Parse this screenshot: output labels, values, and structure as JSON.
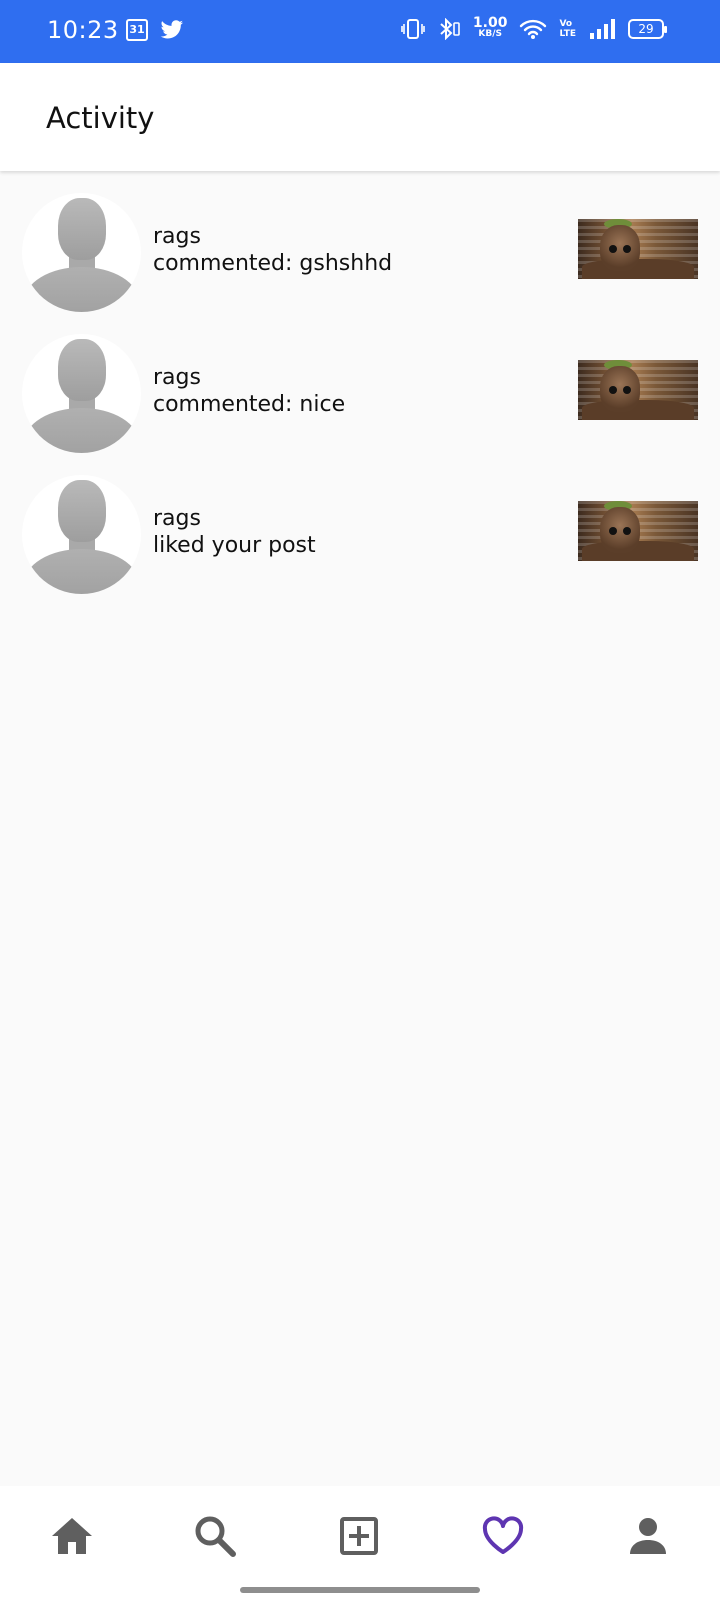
{
  "status_bar": {
    "time": "10:23",
    "calendar_day": "31",
    "net_speed_value": "1.00",
    "net_speed_unit": "KB/S",
    "volte_top": "Vo",
    "volte_bottom": "LTE",
    "battery": "29",
    "icons": [
      "calendar-icon",
      "twitter-icon",
      "vibrate-icon",
      "bluetooth-icon",
      "wifi-icon",
      "signal-icon",
      "battery-icon"
    ]
  },
  "header": {
    "title": "Activity"
  },
  "activities": [
    {
      "username": "rags",
      "text": "commented: gshshhd"
    },
    {
      "username": "rags",
      "text": "commented: nice"
    },
    {
      "username": "rags",
      "text": "liked your post"
    }
  ],
  "bottom_nav": {
    "items": [
      "home-icon",
      "search-icon",
      "add-post-icon",
      "heart-icon",
      "profile-icon"
    ],
    "active": "heart-icon",
    "active_color": "#5e35b1",
    "inactive_color": "#5f5f5f"
  },
  "colors": {
    "status_bar": "#2f6ef0",
    "background": "#fafafa"
  }
}
